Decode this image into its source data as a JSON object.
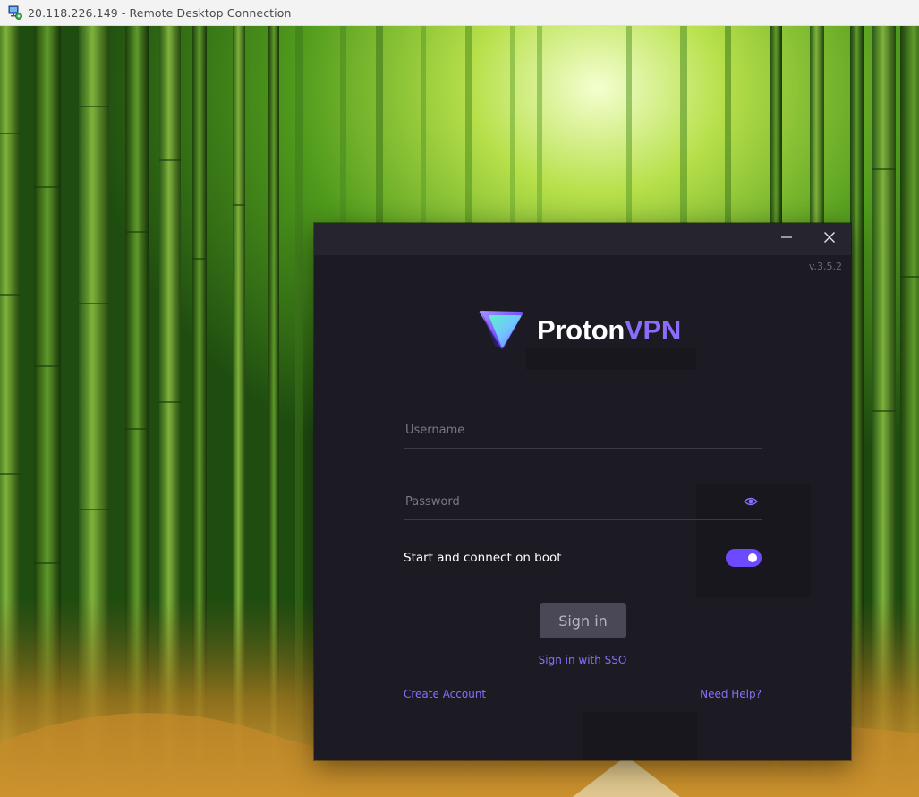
{
  "rdp": {
    "title": "20.118.226.149 - Remote Desktop Connection",
    "icon": "remote-desktop-icon"
  },
  "app": {
    "version": "v.3.5.2",
    "logo": {
      "word1": "Proton",
      "word2": "VPN"
    },
    "window_controls": {
      "minimize": "minimize-icon",
      "close": "close-icon"
    },
    "form": {
      "username_placeholder": "Username",
      "username_value": "",
      "password_placeholder": "Password",
      "password_value": "",
      "boot_label": "Start and connect on boot",
      "boot_enabled": true,
      "signin_label": "Sign in",
      "sso_label": "Sign in with SSO",
      "create_account_label": "Create Account",
      "need_help_label": "Need Help?"
    },
    "colors": {
      "accent": "#8b6dfa",
      "toggle_on": "#6d4aff",
      "window_bg": "#1c1b24",
      "titlebar_bg": "#26242e",
      "button_disabled": "#4a4857"
    }
  }
}
